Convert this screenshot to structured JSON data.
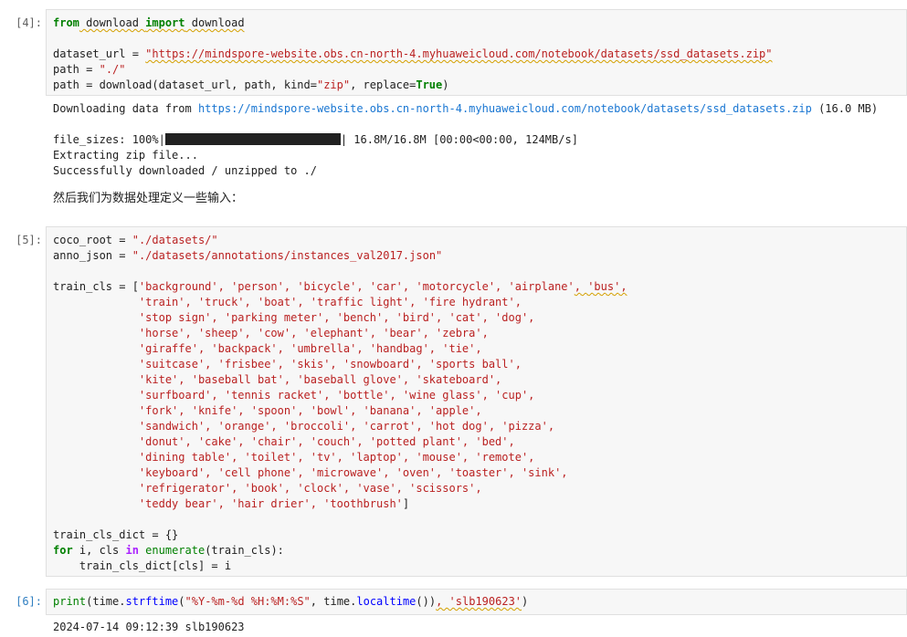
{
  "cell4": {
    "prompt": "[4]:",
    "line1": {
      "kw_from": "from",
      "mod": " download ",
      "kw_import": "import",
      "name": " download"
    },
    "line3": {
      "var": "dataset_url",
      "eq": " = ",
      "str": "\"https://mindspore-website.obs.cn-north-4.myhuaweicloud.com/notebook/datasets/ssd_datasets.zip\""
    },
    "line4": {
      "var": "path",
      "eq": " = ",
      "str": "\"./\""
    },
    "line5": {
      "pre": "path = download(dataset_url, path, kind=",
      "str": "\"zip\"",
      "mid": ", replace=",
      "bool": "True",
      "post": ")"
    },
    "output": {
      "download_prefix": "Downloading data from ",
      "download_url": "https://mindspore-website.obs.cn-north-4.myhuaweicloud.com/notebook/datasets/ssd_datasets.zip",
      "download_suffix": " (16.0 MB)",
      "progress_prefix": "file_sizes: 100%|",
      "progress_fraction": 1.0,
      "progress_suffix": "| 16.8M/16.8M [00:00<00:00, 124MB/s]",
      "extracting": "Extracting zip file...",
      "success": "Successfully downloaded / unzipped to ./"
    }
  },
  "markdown": {
    "text": "然后我们为数据处理定义一些输入："
  },
  "cell5": {
    "prompt": "[5]:",
    "coco_root": {
      "var": "coco_root",
      "eq": " = ",
      "str": "\"./datasets/\""
    },
    "anno_json": {
      "var": "anno_json",
      "eq": " = ",
      "str": "\"./datasets/annotations/instances_val2017.json\""
    },
    "train_cls_first_prefix": "train_cls = [",
    "train_cls_first_items": "'background', 'person', 'bicycle', 'car', 'motorcycle', 'airplane'",
    "train_cls_first_squig": ", 'bus',",
    "train_cls_lines": [
      "'train', 'truck', 'boat', 'traffic light', 'fire hydrant',",
      "'stop sign', 'parking meter', 'bench', 'bird', 'cat', 'dog',",
      "'horse', 'sheep', 'cow', 'elephant', 'bear', 'zebra',",
      "'giraffe', 'backpack', 'umbrella', 'handbag', 'tie',",
      "'suitcase', 'frisbee', 'skis', 'snowboard', 'sports ball',",
      "'kite', 'baseball bat', 'baseball glove', 'skateboard',",
      "'surfboard', 'tennis racket', 'bottle', 'wine glass', 'cup',",
      "'fork', 'knife', 'spoon', 'bowl', 'banana', 'apple',",
      "'sandwich', 'orange', 'broccoli', 'carrot', 'hot dog', 'pizza',",
      "'donut', 'cake', 'chair', 'couch', 'potted plant', 'bed',",
      "'dining table', 'toilet', 'tv', 'laptop', 'mouse', 'remote',",
      "'keyboard', 'cell phone', 'microwave', 'oven', 'toaster', 'sink',",
      "'refrigerator', 'book', 'clock', 'vase', 'scissors',"
    ],
    "train_cls_last_items": "'teddy bear', 'hair drier', 'toothbrush'",
    "train_cls_last_close": "]",
    "dict_line": {
      "pre": "train_cls_dict = ",
      "post": "{}"
    },
    "for_line": {
      "kw_for": "for",
      "mid1": " i, cls ",
      "kw_in": "in",
      "sp": " ",
      "fn": "enumerate",
      "post": "(train_cls):"
    },
    "assign_line": "    train_cls_dict[cls] = i"
  },
  "cell6": {
    "prompt": "[6]:",
    "code": {
      "fn_print": "print",
      "open": "(time.",
      "fn_strftime": "strftime",
      "str_fmt": "\"%Y-%m-%d %H:%M:%S\"",
      "mid": ", time.",
      "fn_localtime": "localtime",
      "after": "())",
      "squig_str": ", 'slb190623'",
      "close": ")"
    },
    "output": "2024-07-14 09:12:39 slb190623"
  },
  "colors": {
    "keyword": "#008000",
    "string": "#ba2121",
    "function": "#0000ff",
    "link": "#1976d2",
    "prompt_active": "#307fc1"
  }
}
